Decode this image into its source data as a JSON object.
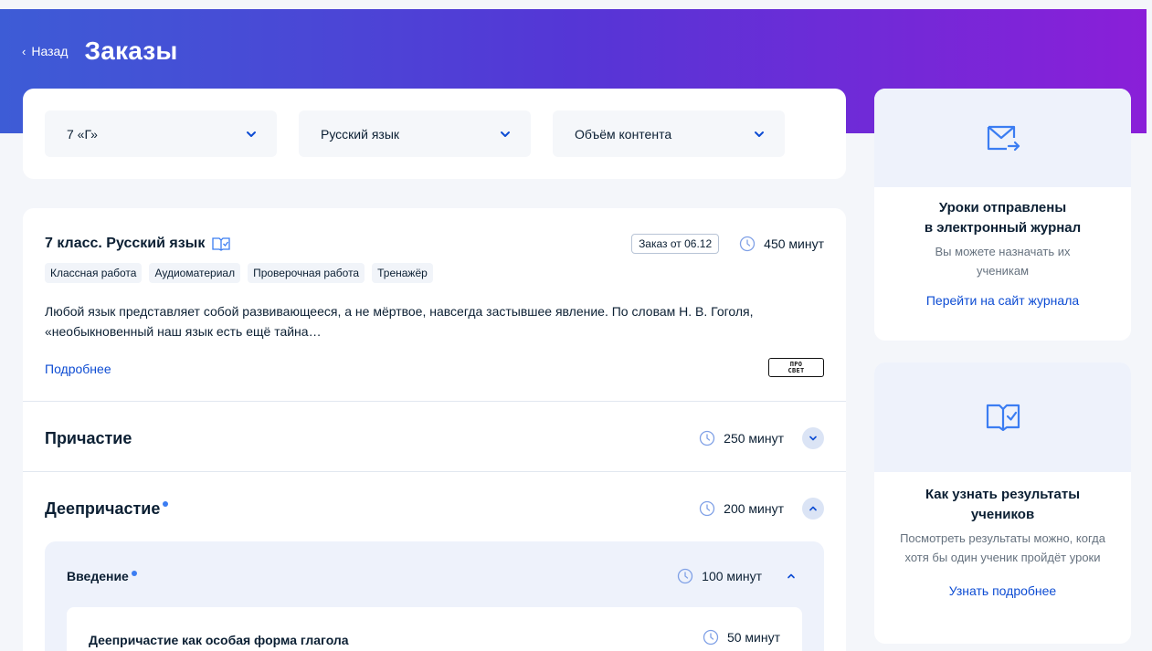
{
  "header": {
    "back_label": "Назад",
    "title": "Заказы"
  },
  "filters": {
    "class_value": "7 «Г»",
    "subject_value": "Русский язык",
    "volume_value": "Объём контента"
  },
  "order": {
    "title": "7 класс. Русский язык",
    "badge": "Заказ от 06.12",
    "duration": "450 минут",
    "tags": [
      "Классная работа",
      "Аудиоматериал",
      "Проверочная работа",
      "Тренажёр"
    ],
    "description": "Любой язык представляет собой развивающееся, а не мёртвое, навсегда застывшее явление. По словам Н. В. Гоголя, «необыкновенный наш язык есть ещё тайна…",
    "more_link": "Подробнее",
    "publisher_logo_line1": "ПРО",
    "publisher_logo_line2": "СВЕТ"
  },
  "sections": [
    {
      "title": "Причастие",
      "duration": "250 минут",
      "expanded": false,
      "new": false
    },
    {
      "title": "Деепричастие",
      "duration": "200 минут",
      "expanded": true,
      "new": true
    }
  ],
  "subsection": {
    "title": "Введение",
    "duration": "100 минут",
    "new": true
  },
  "lesson": {
    "title": "Деепричастие как особая форма глагола",
    "duration": "50 минут"
  },
  "side_cards": [
    {
      "icon": "mail-forward-icon",
      "title_line1": "Уроки отправлены",
      "title_line2": "в электронный журнал",
      "text": "Вы можете назначать их ученикам",
      "link": "Перейти на сайт журнала"
    },
    {
      "icon": "book-check-icon",
      "title": "Как узнать результаты учеников",
      "text": "Посмотреть результаты можно, когда хотя бы один ученик пройдёт уроки",
      "link": "Узнать подробнее"
    }
  ],
  "colors": {
    "accent": "#0d4cd3",
    "gradient_start": "#3d5cd6",
    "gradient_end": "#8a1fd8",
    "new_dot": "#3b7df2"
  }
}
